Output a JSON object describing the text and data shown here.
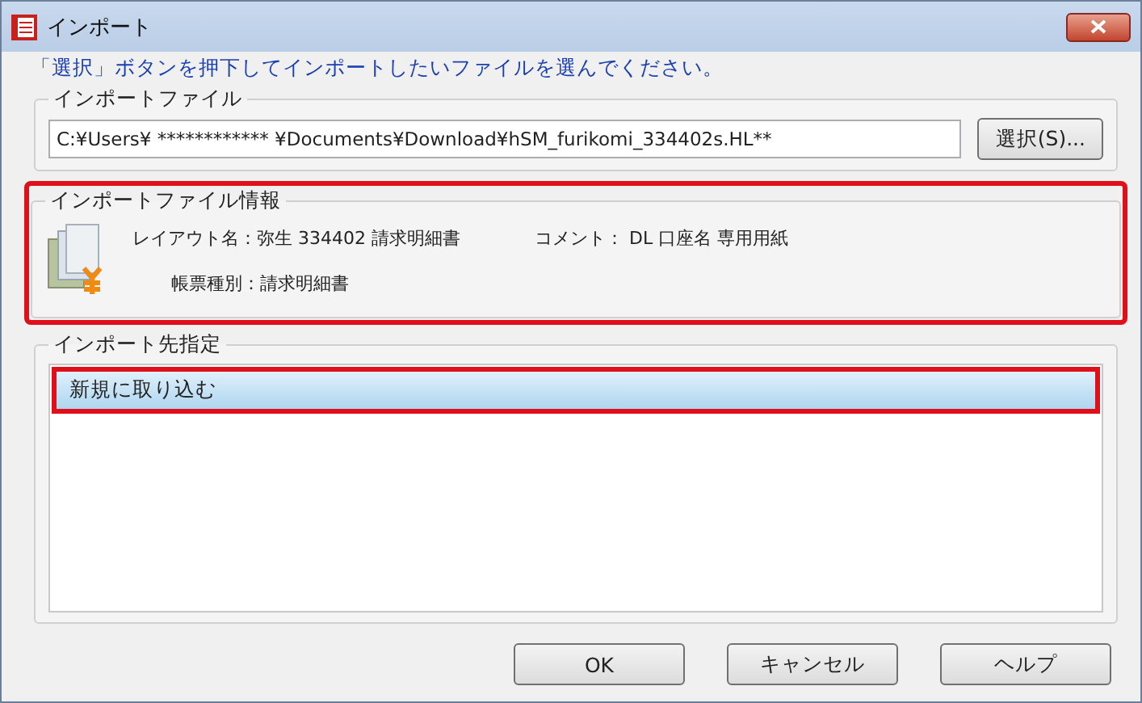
{
  "window": {
    "title": "インポート"
  },
  "instruction": "「選択」ボタンを押下してインポートしたいファイルを選んでください。",
  "import_file": {
    "legend": "インポートファイル",
    "path": "C:¥Users¥ ************ ¥Documents¥Download¥hSM_furikomi_334402s.HL**",
    "button": "選択(S)..."
  },
  "file_info": {
    "legend": "インポートファイル情報",
    "highlighted": true,
    "layout_name": "レイアウト名：弥生 334402 請求明細書",
    "comment": "コメント：  DL 口座名 専用用紙",
    "form_type": "帳票種別：請求明細書"
  },
  "destination": {
    "legend": "インポート先指定",
    "items": [
      {
        "label": "新規に取り込む",
        "selected": true,
        "highlighted": true
      }
    ]
  },
  "buttons": [
    "OK",
    "キャンセル",
    "ヘルプ"
  ]
}
